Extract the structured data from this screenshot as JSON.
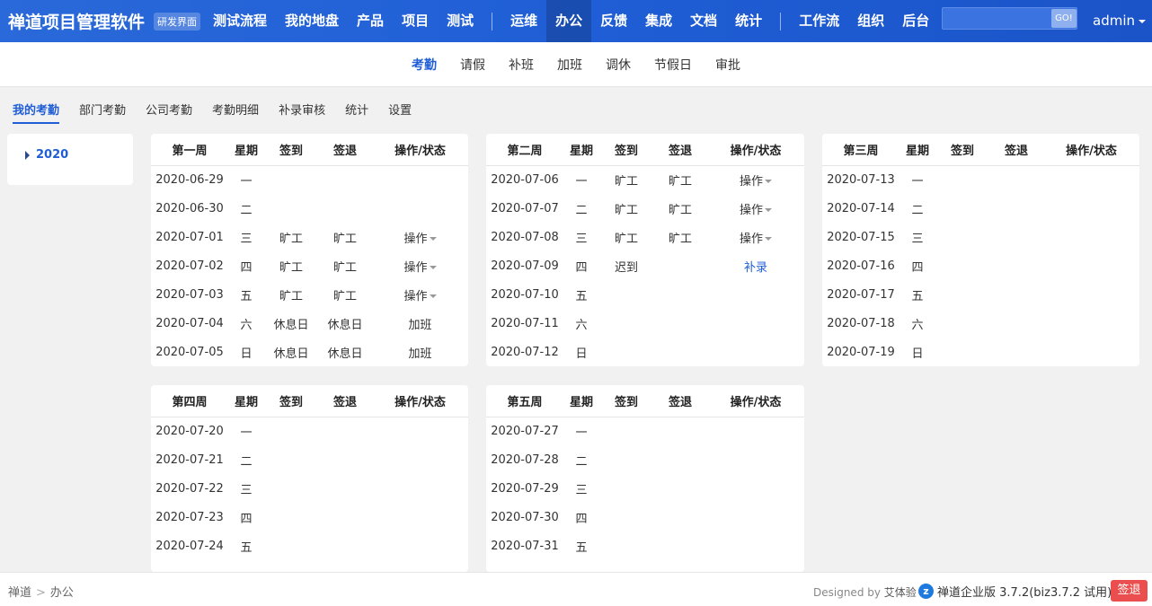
{
  "header": {
    "brand": "禅道项目管理软件",
    "edition": "研发界面",
    "nav_left": [
      "测试流程",
      "我的地盘",
      "产品",
      "项目",
      "测试"
    ],
    "nav_mid": [
      "运维",
      "办公",
      "反馈",
      "集成",
      "文档",
      "统计"
    ],
    "nav_mid_active": "办公",
    "nav_right": [
      "工作流",
      "组织",
      "后台"
    ],
    "search": {
      "value": "",
      "placeholder": "",
      "button": "GO!"
    },
    "user": "admin"
  },
  "subnav": {
    "items": [
      "考勤",
      "请假",
      "补班",
      "加班",
      "调休",
      "节假日",
      "审批"
    ],
    "active": "考勤"
  },
  "tabs": {
    "items": [
      "我的考勤",
      "部门考勤",
      "公司考勤",
      "考勤明细",
      "补录审核",
      "统计",
      "设置"
    ],
    "active": "我的考勤"
  },
  "year": "2020",
  "columns": {
    "weekday": "星期",
    "signin": "签到",
    "signout": "签退",
    "action": "操作/状态"
  },
  "weeks": [
    {
      "title": "第一周",
      "rows": [
        {
          "date": "2020-06-29",
          "wd": "一",
          "in": "",
          "out": "",
          "act": "",
          "type": "muted"
        },
        {
          "date": "2020-06-30",
          "wd": "二",
          "in": "",
          "out": "",
          "act": "",
          "type": "muted"
        },
        {
          "date": "2020-07-01",
          "wd": "三",
          "in": "旷工",
          "out": "旷工",
          "act": "操作",
          "type": "absent"
        },
        {
          "date": "2020-07-02",
          "wd": "四",
          "in": "旷工",
          "out": "旷工",
          "act": "操作",
          "type": "absent"
        },
        {
          "date": "2020-07-03",
          "wd": "五",
          "in": "旷工",
          "out": "旷工",
          "act": "操作",
          "type": "absent"
        },
        {
          "date": "2020-07-04",
          "wd": "六",
          "in": "休息日",
          "out": "休息日",
          "act": "加班",
          "type": "rest"
        },
        {
          "date": "2020-07-05",
          "wd": "日",
          "in": "休息日",
          "out": "休息日",
          "act": "加班",
          "type": "rest"
        }
      ]
    },
    {
      "title": "第二周",
      "rows": [
        {
          "date": "2020-07-06",
          "wd": "一",
          "in": "旷工",
          "out": "旷工",
          "act": "操作",
          "type": "absent"
        },
        {
          "date": "2020-07-07",
          "wd": "二",
          "in": "旷工",
          "out": "旷工",
          "act": "操作",
          "type": "absent"
        },
        {
          "date": "2020-07-08",
          "wd": "三",
          "in": "旷工",
          "out": "旷工",
          "act": "操作",
          "type": "absent"
        },
        {
          "date": "2020-07-09",
          "wd": "四",
          "in": "迟到",
          "out": "",
          "act": "补录",
          "type": "late"
        },
        {
          "date": "2020-07-10",
          "wd": "五",
          "in": "",
          "out": "",
          "act": "",
          "type": "plain"
        },
        {
          "date": "2020-07-11",
          "wd": "六",
          "in": "",
          "out": "",
          "act": "",
          "type": "plain"
        },
        {
          "date": "2020-07-12",
          "wd": "日",
          "in": "",
          "out": "",
          "act": "",
          "type": "plain"
        }
      ]
    },
    {
      "title": "第三周",
      "rows": [
        {
          "date": "2020-07-13",
          "wd": "一",
          "in": "",
          "out": "",
          "act": "",
          "type": "plain"
        },
        {
          "date": "2020-07-14",
          "wd": "二",
          "in": "",
          "out": "",
          "act": "",
          "type": "plain"
        },
        {
          "date": "2020-07-15",
          "wd": "三",
          "in": "",
          "out": "",
          "act": "",
          "type": "plain"
        },
        {
          "date": "2020-07-16",
          "wd": "四",
          "in": "",
          "out": "",
          "act": "",
          "type": "plain"
        },
        {
          "date": "2020-07-17",
          "wd": "五",
          "in": "",
          "out": "",
          "act": "",
          "type": "plain"
        },
        {
          "date": "2020-07-18",
          "wd": "六",
          "in": "",
          "out": "",
          "act": "",
          "type": "plain"
        },
        {
          "date": "2020-07-19",
          "wd": "日",
          "in": "",
          "out": "",
          "act": "",
          "type": "plain"
        }
      ]
    },
    {
      "title": "第四周",
      "rows": [
        {
          "date": "2020-07-20",
          "wd": "一",
          "in": "",
          "out": "",
          "act": "",
          "type": "plain"
        },
        {
          "date": "2020-07-21",
          "wd": "二",
          "in": "",
          "out": "",
          "act": "",
          "type": "plain"
        },
        {
          "date": "2020-07-22",
          "wd": "三",
          "in": "",
          "out": "",
          "act": "",
          "type": "plain"
        },
        {
          "date": "2020-07-23",
          "wd": "四",
          "in": "",
          "out": "",
          "act": "",
          "type": "plain"
        },
        {
          "date": "2020-07-24",
          "wd": "五",
          "in": "",
          "out": "",
          "act": "",
          "type": "plain"
        }
      ]
    },
    {
      "title": "第五周",
      "rows": [
        {
          "date": "2020-07-27",
          "wd": "一",
          "in": "",
          "out": "",
          "act": "",
          "type": "plain"
        },
        {
          "date": "2020-07-28",
          "wd": "二",
          "in": "",
          "out": "",
          "act": "",
          "type": "plain"
        },
        {
          "date": "2020-07-29",
          "wd": "三",
          "in": "",
          "out": "",
          "act": "",
          "type": "plain"
        },
        {
          "date": "2020-07-30",
          "wd": "四",
          "in": "",
          "out": "",
          "act": "",
          "type": "plain"
        },
        {
          "date": "2020-07-31",
          "wd": "五",
          "in": "",
          "out": "",
          "act": "",
          "type": "plain"
        }
      ]
    }
  ],
  "footer": {
    "breadcrumb": [
      "禅道",
      "办公"
    ],
    "designed_prefix": "Designed by",
    "designed_by": "艾体验",
    "version": "禅道企业版 3.7.2(biz3.7.2 试用)",
    "signout": "签退"
  },
  "colors": {
    "primary": "#1f5ed6",
    "absent": "#f08a00",
    "late": "#e03a2e",
    "rest": "#2e6bd1",
    "signout_btn": "#ea4e4e"
  }
}
